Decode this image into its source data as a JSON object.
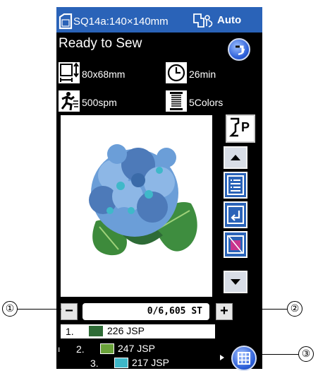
{
  "header": {
    "hoop_label": "SQ14a:140×140mm",
    "mode_label": "Auto",
    "hoop_icon": "hoop-icon",
    "mode_icon": "auto-threader-icon"
  },
  "status": "Ready to Sew",
  "info": {
    "size": "80x68mm",
    "time": "26min",
    "speed": "500spm",
    "colors": "5Colors"
  },
  "stitch_counter": "0/6,605 ST",
  "colors_list": [
    {
      "num": "1.",
      "swatch": "#2e6b36",
      "label": "226 JSP"
    },
    {
      "num": "2.",
      "swatch": "#6aa23a",
      "label": "247 JSP"
    },
    {
      "num": "3.",
      "swatch": "#3fb8c9",
      "label": "217 JSP"
    }
  ],
  "buttons": {
    "minus": "−",
    "plus": "+"
  },
  "callouts": [
    "①",
    "②",
    "③"
  ],
  "accent": "#2a63b8"
}
